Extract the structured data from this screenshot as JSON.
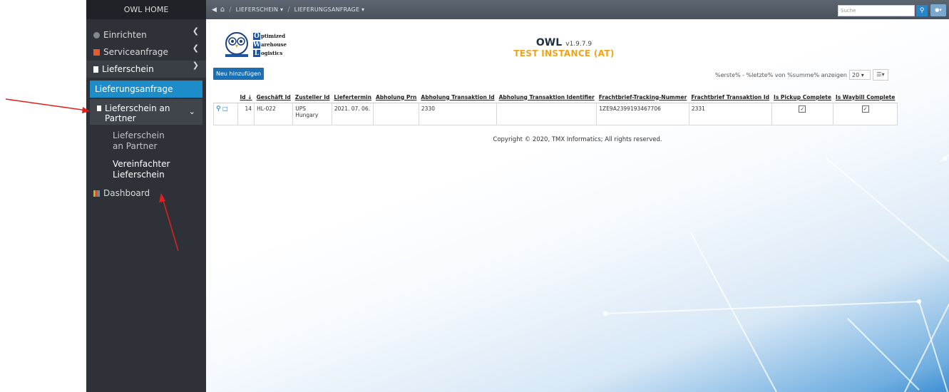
{
  "sidebar": {
    "header": "OWL HOME",
    "items": [
      {
        "label": "Einrichten",
        "icon": "gear-icon"
      },
      {
        "label": "Serviceanfrage",
        "icon": "ticket-icon"
      },
      {
        "label": "Lieferschein",
        "icon": "document-icon"
      }
    ],
    "active": "Lieferungsanfrage",
    "submenu": {
      "label": "Lieferschein an Partner"
    },
    "leaves": [
      "Lieferschein an Partner",
      "Vereinfachter Lieferschein"
    ],
    "dashboard": "Dashboard"
  },
  "topbar": {
    "crumb1": "LIEFERSCHEIN",
    "crumb2": "LIEFERUNGSANFRAGE",
    "search_placeholder": "Suche"
  },
  "logo": {
    "w1": "ptimized",
    "w2": "arehouse",
    "w3": "ogistics",
    "c1": "O",
    "c2": "W",
    "c3": "L"
  },
  "app": {
    "name": "OWL",
    "version": "v1.9.7.9",
    "instance": "TEST INSTANCE (AT)"
  },
  "toolbar": {
    "add_label": "Neu hinzufügen"
  },
  "pager": {
    "text": "%erste% - %letzte% von %summe% anzeigen",
    "page_size": "20"
  },
  "table": {
    "columns": [
      "Id",
      "Geschäft Id",
      "Zusteller Id",
      "Liefertermin",
      "Abholung Prn",
      "Abholung Transaktion Id",
      "Abholung Transaktion Identifier",
      "Frachtbrief-Tracking-Nummer",
      "Frachtbrief Transaktion Id",
      "Is Pickup Complete",
      "Is Waybill Complete"
    ],
    "rows": [
      {
        "id": "14",
        "geschaeft": "HL-022",
        "zusteller": "UPS Hungary",
        "liefertermin": "2021. 07. 06.",
        "prn": "",
        "trans_id": "2330",
        "trans_ident": "",
        "tracking": "1ZE9A2399193467706",
        "fb_trans": "2331",
        "pickup_complete": true,
        "waybill_complete": true
      }
    ]
  },
  "footer": {
    "copyright": "Copyright © 2020, TMX Informatics; All rights reserved."
  }
}
